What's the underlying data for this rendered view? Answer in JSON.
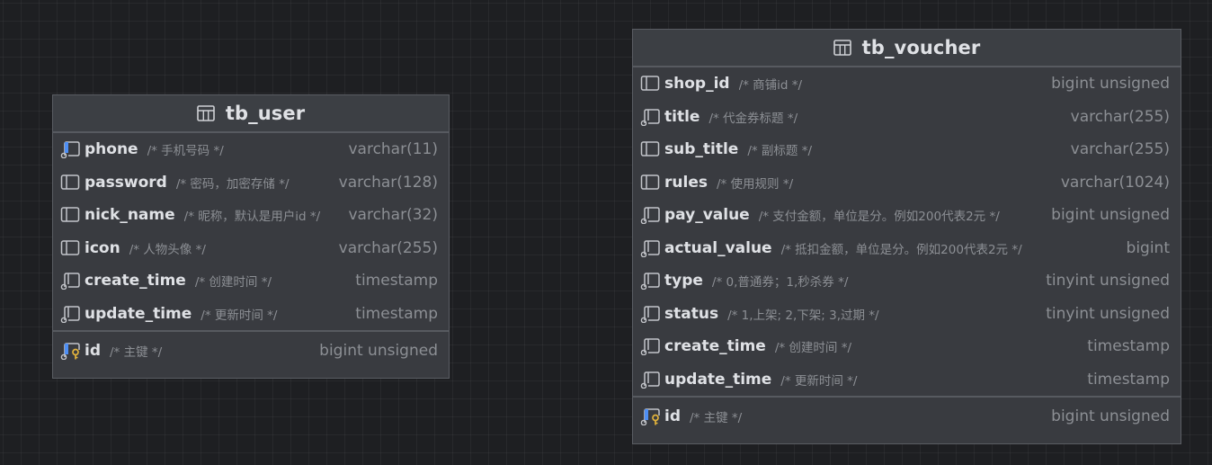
{
  "tables": [
    {
      "id": "user",
      "name": "tb_user",
      "columns": [
        {
          "name": "phone",
          "comment": "/* 手机号码 */",
          "type": "varchar(11)",
          "icon": "column-indexed-icon"
        },
        {
          "name": "password",
          "comment": "/* 密码，加密存储 */",
          "type": "varchar(128)",
          "icon": "column-icon"
        },
        {
          "name": "nick_name",
          "comment": "/* 昵称，默认是用户id */",
          "type": "varchar(32)",
          "icon": "column-icon"
        },
        {
          "name": "icon",
          "comment": "/* 人物头像 */",
          "type": "varchar(255)",
          "icon": "column-icon"
        },
        {
          "name": "create_time",
          "comment": "/* 创建时间 */",
          "type": "timestamp",
          "icon": "column-notnull-icon"
        },
        {
          "name": "update_time",
          "comment": "/* 更新时间 */",
          "type": "timestamp",
          "icon": "column-notnull-icon"
        }
      ],
      "primary_key": {
        "name": "id",
        "comment": "/* 主键 */",
        "type": "bigint unsigned",
        "icon": "primary-key-icon"
      }
    },
    {
      "id": "voucher",
      "name": "tb_voucher",
      "columns": [
        {
          "name": "shop_id",
          "comment": "/* 商铺id */",
          "type": "bigint unsigned",
          "icon": "column-icon"
        },
        {
          "name": "title",
          "comment": "/* 代金券标题 */",
          "type": "varchar(255)",
          "icon": "column-notnull-icon"
        },
        {
          "name": "sub_title",
          "comment": "/* 副标题 */",
          "type": "varchar(255)",
          "icon": "column-icon"
        },
        {
          "name": "rules",
          "comment": "/* 使用规则 */",
          "type": "varchar(1024)",
          "icon": "column-icon"
        },
        {
          "name": "pay_value",
          "comment": "/* 支付金额，单位是分。例如200代表2元 */",
          "type": "bigint unsigned",
          "icon": "column-notnull-icon"
        },
        {
          "name": "actual_value",
          "comment": "/* 抵扣金额，单位是分。例如200代表2元 */",
          "type": "bigint",
          "icon": "column-notnull-icon"
        },
        {
          "name": "type",
          "comment": "/* 0,普通券；1,秒杀券 */",
          "type": "tinyint unsigned",
          "icon": "column-notnull-icon"
        },
        {
          "name": "status",
          "comment": "/* 1,上架; 2,下架; 3,过期 */",
          "type": "tinyint unsigned",
          "icon": "column-notnull-icon"
        },
        {
          "name": "create_time",
          "comment": "/* 创建时间 */",
          "type": "timestamp",
          "icon": "column-notnull-icon"
        },
        {
          "name": "update_time",
          "comment": "/* 更新时间 */",
          "type": "timestamp",
          "icon": "column-notnull-icon"
        }
      ],
      "primary_key": {
        "name": "id",
        "comment": "/* 主键 */",
        "type": "bigint unsigned",
        "icon": "primary-key-icon"
      }
    }
  ],
  "colors": {
    "background": "#1e1f22",
    "table_body": "#393b40",
    "table_border": "#5a5d63",
    "name_text": "#dfe1e5",
    "muted_text": "#8c8f94",
    "index_accent": "#4e8ff5",
    "key_accent": "#e2b33c"
  }
}
